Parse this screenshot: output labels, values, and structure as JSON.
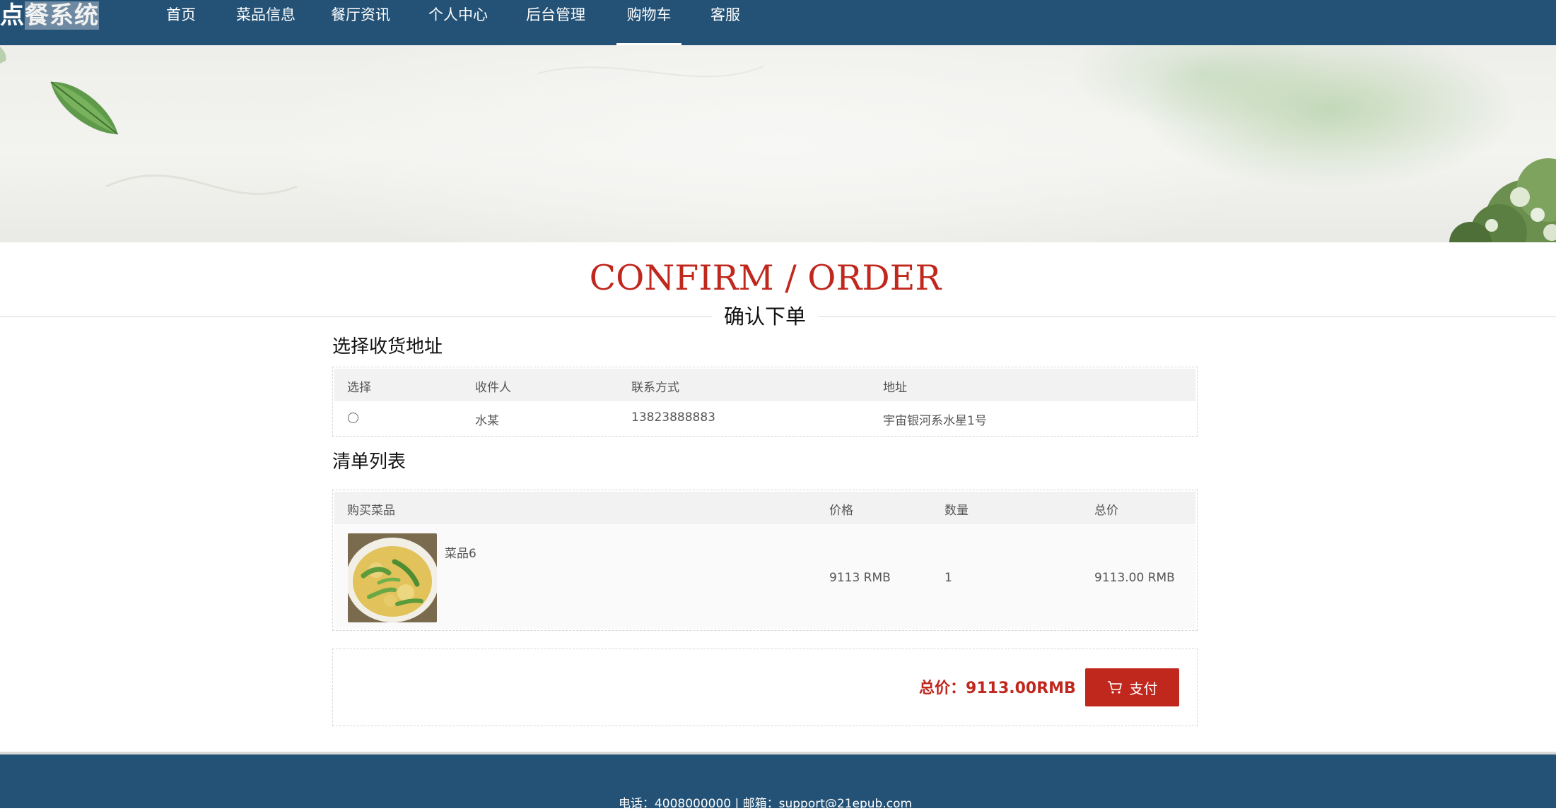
{
  "brand": {
    "part1": "点",
    "part2": "餐系统"
  },
  "nav": [
    {
      "label": "首页"
    },
    {
      "label": "菜品信息"
    },
    {
      "label": "餐厅资讯"
    },
    {
      "label": "个人中心"
    },
    {
      "label": "后台管理"
    },
    {
      "label": "购物车",
      "active": true
    },
    {
      "label": "客服"
    }
  ],
  "page": {
    "heading_en": "CONFIRM / ORDER",
    "heading_cn": "确认下单"
  },
  "address_section": {
    "title": "选择收货地址",
    "columns": [
      "选择",
      "收件人",
      "联系方式",
      "地址"
    ],
    "rows": [
      {
        "selected": false,
        "recipient": "水某",
        "phone": "13823888883",
        "address": "宇宙银河系水星1号"
      }
    ]
  },
  "order_section": {
    "title": "清单列表",
    "columns": [
      "购买菜品",
      "价格",
      "数量",
      "总价"
    ],
    "items": [
      {
        "name": "菜品6",
        "price": "9113 RMB",
        "quantity": "1",
        "total": "9113.00 RMB"
      }
    ]
  },
  "summary": {
    "total_label": "总价：",
    "total_value": "9113.00RMB",
    "pay_label": "支付"
  },
  "footer": {
    "text": "电话：4008000000 | 邮箱：support@21epub.com"
  },
  "colors": {
    "primary": "#245276",
    "accent": "#c0281e",
    "header_row": "#f2f2f2"
  }
}
